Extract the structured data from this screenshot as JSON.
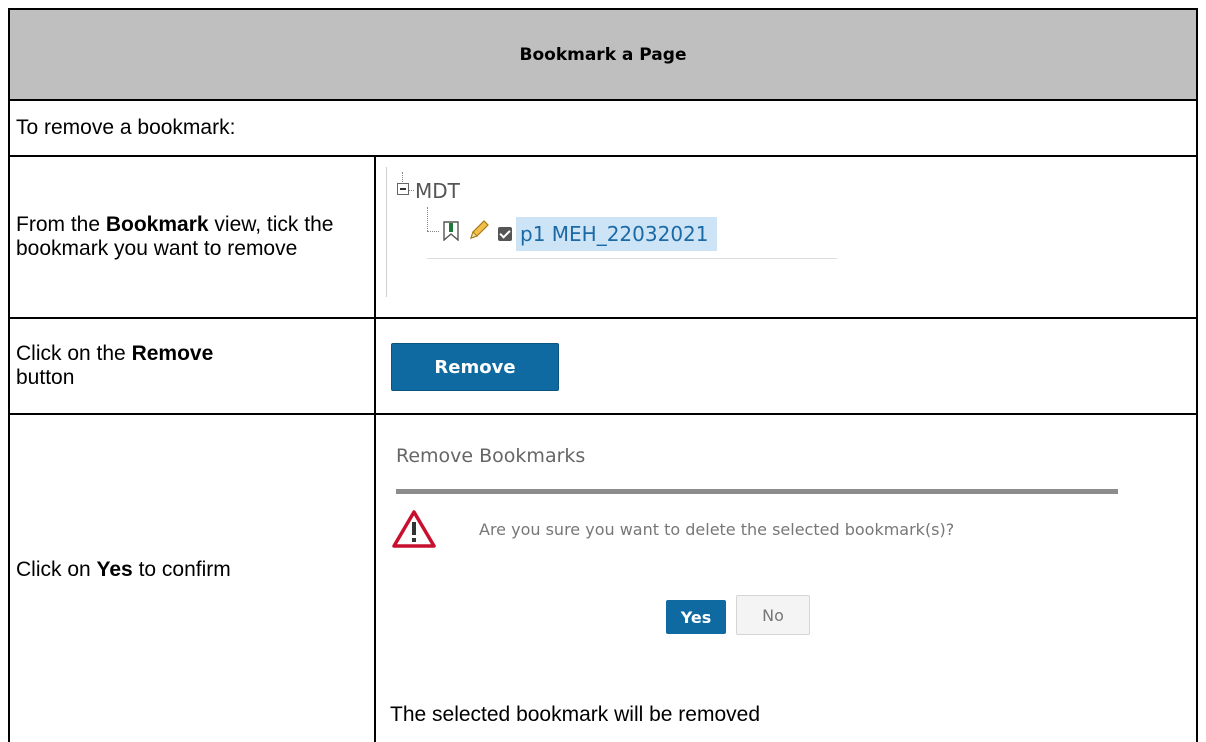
{
  "title": "Bookmark a Page",
  "intro": "To remove a bookmark:",
  "steps": [
    {
      "before": "From the ",
      "bold": "Bookmark",
      "after": " view, tick the bookmark you want to remove",
      "tree": {
        "root": "MDT",
        "item": "p1 MEH_22032021"
      }
    },
    {
      "before": "Click on the ",
      "bold": "Remove",
      "after": " button",
      "button": "Remove"
    },
    {
      "before": "Click on ",
      "bold": "Yes",
      "after": " to confirm",
      "dialog": {
        "title": "Remove Bookmarks",
        "message": "Are you sure you want to delete the selected bookmark(s)?",
        "yes": "Yes",
        "no": "No"
      },
      "result": "The selected bookmark will be removed"
    }
  ],
  "colors": {
    "header_bg": "#bfbfbf",
    "primary_button": "#0e6aa0",
    "selection_bg": "#cde4f7",
    "warning": "#c8102e"
  },
  "icons": [
    "expander-icon",
    "bookmark-icon",
    "pencil-icon",
    "checkbox-icon",
    "warning-icon"
  ]
}
